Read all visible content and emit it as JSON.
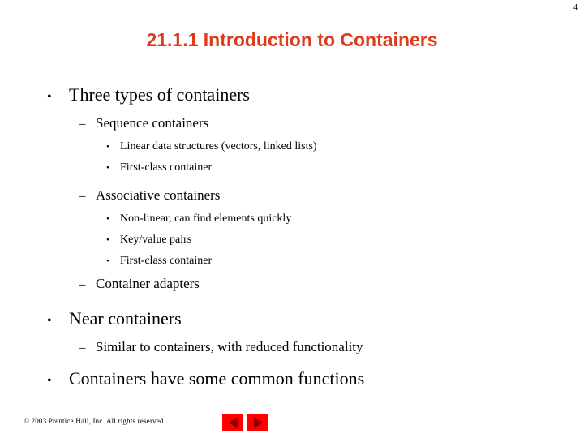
{
  "slide": {
    "page_number": "4",
    "title": "21.1.1 Introduction to Containers",
    "title_color": "#DD3B1A",
    "background_color": "#FFFFFF",
    "text_color": "#000000"
  },
  "content": {
    "bullets": [
      {
        "level": 1,
        "marker": "•",
        "text": "Three types of containers"
      },
      {
        "level": 2,
        "marker": "–",
        "text": "Sequence containers"
      },
      {
        "level": 3,
        "marker": "•",
        "text": "Linear data structures (vectors, linked lists)"
      },
      {
        "level": 3,
        "marker": "•",
        "text": "First-class container"
      },
      {
        "level": 2,
        "marker": "–",
        "text": "Associative containers"
      },
      {
        "level": 3,
        "marker": "•",
        "text": "Non-linear, can find elements quickly"
      },
      {
        "level": 3,
        "marker": "•",
        "text": "Key/value pairs"
      },
      {
        "level": 3,
        "marker": "•",
        "text": "First-class container"
      },
      {
        "level": 2,
        "marker": "–",
        "text": "Container adapters"
      },
      {
        "level": 1,
        "marker": "•",
        "text": "Near containers"
      },
      {
        "level": 2,
        "marker": "–",
        "text": "Similar to containers, with reduced functionality"
      },
      {
        "level": 1,
        "marker": "•",
        "text": "Containers have some common functions"
      }
    ]
  },
  "footer": {
    "copyright": "© 2003 Prentice Hall, Inc.  All rights reserved.",
    "nav": {
      "previous_label": "◀",
      "next_label": "▶",
      "button_color": "#FF0000",
      "arrow_color": "#8A0000"
    }
  }
}
